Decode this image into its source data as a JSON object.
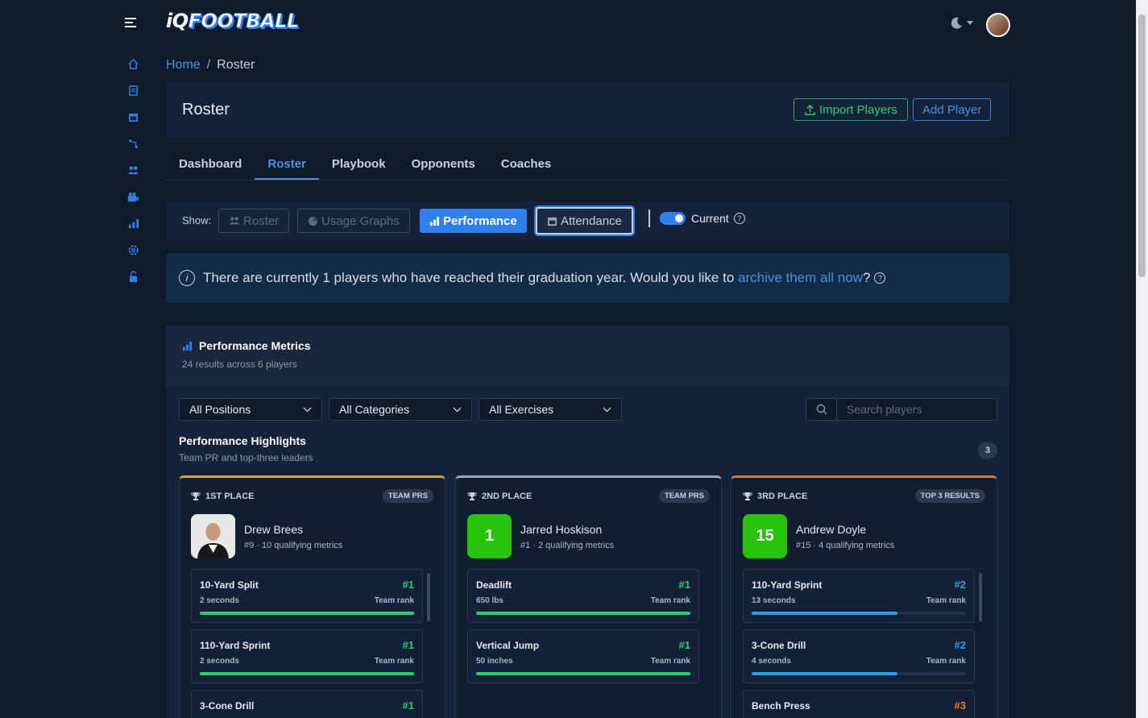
{
  "brand": {
    "iq": "iQ",
    "name": "FOOTBALL"
  },
  "breadcrumb": {
    "home": "Home",
    "separator": "/",
    "current": "Roster"
  },
  "header": {
    "title": "Roster",
    "import_label": "Import Players",
    "add_label": "Add Player"
  },
  "tabs": [
    {
      "label": "Dashboard",
      "active": false
    },
    {
      "label": "Roster",
      "active": true
    },
    {
      "label": "Playbook",
      "active": false
    },
    {
      "label": "Opponents",
      "active": false
    },
    {
      "label": "Coaches",
      "active": false
    }
  ],
  "show": {
    "label": "Show:",
    "buttons": [
      {
        "label": "Roster",
        "icon": "users-icon"
      },
      {
        "label": "Usage Graphs",
        "icon": "pie-chart-icon"
      },
      {
        "label": "Performance",
        "icon": "bar-chart-icon"
      },
      {
        "label": "Attendance",
        "icon": "calendar-icon"
      }
    ],
    "current_label": "Current",
    "current_on": true
  },
  "alert": {
    "text_before": "There are currently 1 players who have reached their graduation year. Would you like to ",
    "link": "archive them all now",
    "text_after": "?"
  },
  "metrics": {
    "title": "Performance Metrics",
    "subtitle": "24 results across 6 players",
    "filters": [
      "All Positions",
      "All Categories",
      "All Exercises"
    ],
    "search_placeholder": "Search players",
    "highlights_title": "Performance Highlights",
    "highlights_sub": "Team PR and top-three leaders",
    "highlights_count": "3"
  },
  "cards": [
    {
      "place": "1ST PLACE",
      "badge": "TEAM PRS",
      "name": "Drew Brees",
      "meta": "#9 · 10 qualifying metrics",
      "avatar": "",
      "items": [
        {
          "name": "10-Yard Split",
          "value": "2 seconds",
          "rank": "#1",
          "rank_label": "Team rank",
          "fill": 1.0,
          "color": "#2ecc71"
        },
        {
          "name": "110-Yard Sprint",
          "value": "2 seconds",
          "rank": "#1",
          "rank_label": "Team rank",
          "fill": 1.0,
          "color": "#2ecc71"
        },
        {
          "name": "3-Cone Drill",
          "value": "",
          "rank": "#1",
          "rank_label": "",
          "fill": 1.0,
          "color": "#2ecc71"
        }
      ]
    },
    {
      "place": "2ND PLACE",
      "badge": "TEAM PRS",
      "name": "Jarred Hoskison",
      "meta": "#1 · 2 qualifying metrics",
      "avatar": "1",
      "items": [
        {
          "name": "Deadlift",
          "value": "650 lbs",
          "rank": "#1",
          "rank_label": "Team rank",
          "fill": 1.0,
          "color": "#2ecc71"
        },
        {
          "name": "Vertical Jump",
          "value": "50 inches",
          "rank": "#1",
          "rank_label": "Team rank",
          "fill": 1.0,
          "color": "#2ecc71"
        }
      ]
    },
    {
      "place": "3RD PLACE",
      "badge": "TOP 3 RESULTS",
      "name": "Andrew Doyle",
      "meta": "#15 · 4 qualifying metrics",
      "avatar": "15",
      "items": [
        {
          "name": "110-Yard Sprint",
          "value": "13 seconds",
          "rank": "#2",
          "rank_label": "Team rank",
          "fill": 0.68,
          "color": "#2f9be6"
        },
        {
          "name": "3-Cone Drill",
          "value": "4 seconds",
          "rank": "#2",
          "rank_label": "Team rank",
          "fill": 0.68,
          "color": "#2f9be6"
        },
        {
          "name": "Bench Press",
          "value": "",
          "rank": "#3",
          "rank_label": "",
          "fill": 0.34,
          "color": "#e67e22"
        }
      ]
    }
  ],
  "sidebar_icons": [
    "home-icon",
    "document-icon",
    "calendar-icon",
    "playbook-icon",
    "users-icon",
    "video-icon",
    "bar-chart-icon",
    "settings-icon",
    "unlock-icon"
  ]
}
